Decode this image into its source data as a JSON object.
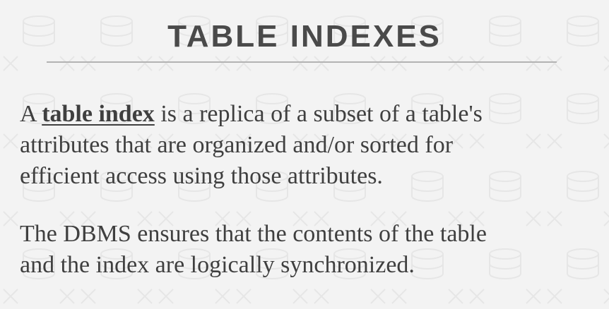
{
  "slide": {
    "title": "TABLE INDEXES",
    "paragraph1": {
      "prefix": "A ",
      "term": "table index",
      "line1_rest": " is a replica of a subset of a table's",
      "line2": "attributes that are organized and/or sorted for",
      "line3": "efficient access using those attributes."
    },
    "paragraph2": {
      "line1": "The DBMS ensures that the contents of the table",
      "line2": "and the index are logically synchronized."
    }
  },
  "colors": {
    "background": "#f3f3f3",
    "title_text": "#4a4a4a",
    "body_text": "#3f3f3f",
    "rule": "#b3b3b3"
  }
}
